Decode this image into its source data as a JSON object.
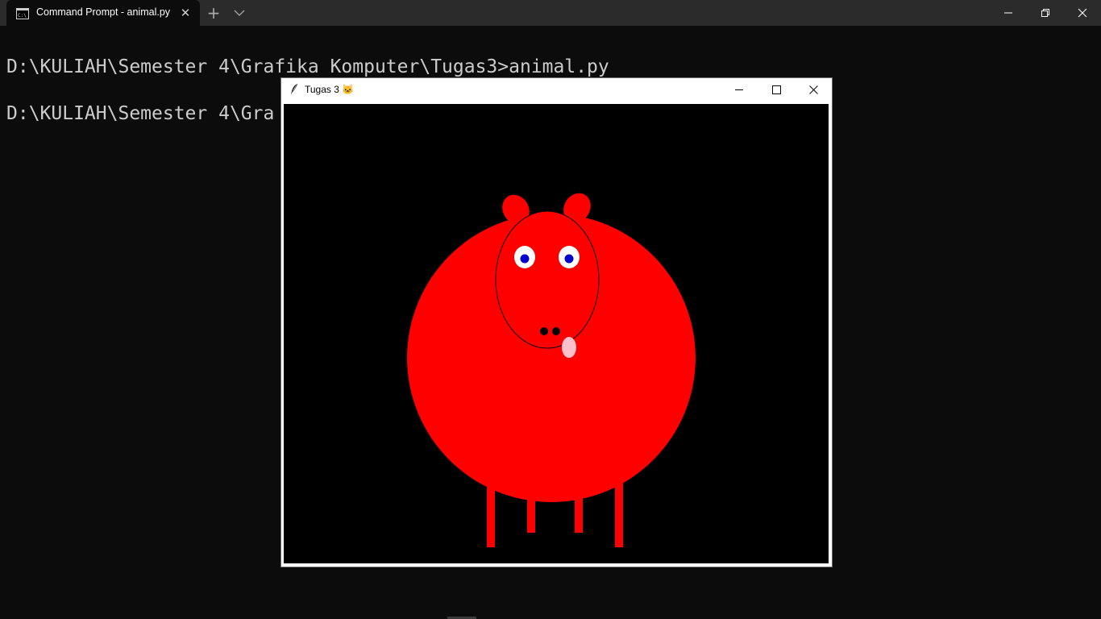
{
  "tab": {
    "title": "Command Prompt - animal.py",
    "close_glyph": "✕",
    "new_tab_glyph": "+",
    "icon": "cmd-icon"
  },
  "window_controls": {
    "minimize_icon": "minimize-icon",
    "restore_icon": "restore-icon",
    "close_icon": "close-icon"
  },
  "terminal": {
    "lines": [
      "D:\\KULIAH\\Semester 4\\Grafika Komputer\\Tugas3>animal.py",
      "D:\\KULIAH\\Semester 4\\Gra"
    ]
  },
  "tk_window": {
    "title": "Tugas 3 🐱",
    "icon": "feather-icon",
    "canvas_background": "#000000",
    "colors": {
      "body": "#ff0000",
      "outline": "#000000",
      "eye_white": "#ffffff",
      "pupil": "#0000cd",
      "tongue": "#ffc0cb",
      "nostril": "#000000"
    }
  }
}
